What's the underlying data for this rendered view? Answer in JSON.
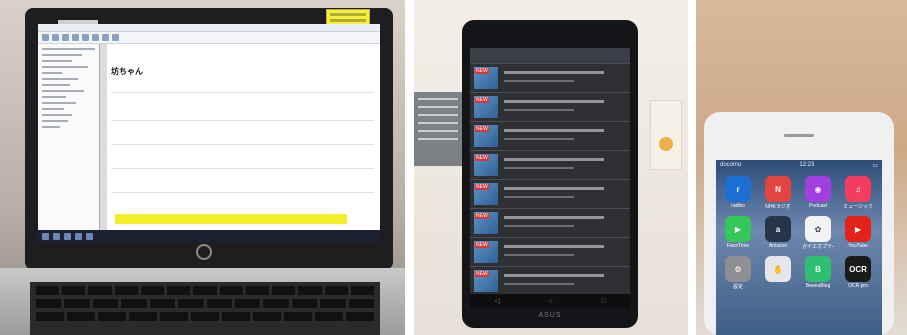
{
  "photos": [
    {
      "name": "laptop-photo",
      "device": "HP laptop",
      "screen_doc_title": "坊ちゃん",
      "highlight_color": "#f4ee2a",
      "logo": "hp"
    },
    {
      "name": "tablet-photo",
      "device": "ASUS tablet",
      "logo": "ASUS",
      "badge_text": "NEW",
      "row_count": 8
    },
    {
      "name": "phone-photo",
      "device": "iPhone",
      "status": {
        "carrier": "docomo",
        "time": "12:23"
      },
      "apps": [
        {
          "label": "radiko",
          "glyph": "r",
          "color": "#1c6fd3"
        },
        {
          "label": "NHKラジオ",
          "glyph": "N",
          "color": "#e2443f"
        },
        {
          "label": "Podcast",
          "glyph": "◉",
          "color": "#a33ee0"
        },
        {
          "label": "ミュージック",
          "glyph": "♫",
          "color": "#f23d61"
        },
        {
          "label": "FaceTime",
          "glyph": "▶",
          "color": "#34c759"
        },
        {
          "label": "Amazon",
          "glyph": "a",
          "color": "#273549"
        },
        {
          "label": "ガイエオプティ",
          "glyph": "✿",
          "color": "#f2f2f2"
        },
        {
          "label": "YouTube",
          "glyph": "▶",
          "color": "#e62117"
        },
        {
          "label": "設定",
          "glyph": "⚙",
          "color": "#8e8e93"
        },
        {
          "label": "",
          "glyph": "✋",
          "color": "#e6e6ea"
        },
        {
          "label": "BeeeaBlog",
          "glyph": "B",
          "color": "#2fbf71"
        },
        {
          "label": "OCR pro",
          "glyph": "OCR",
          "color": "#1a1a1a"
        }
      ]
    }
  ]
}
